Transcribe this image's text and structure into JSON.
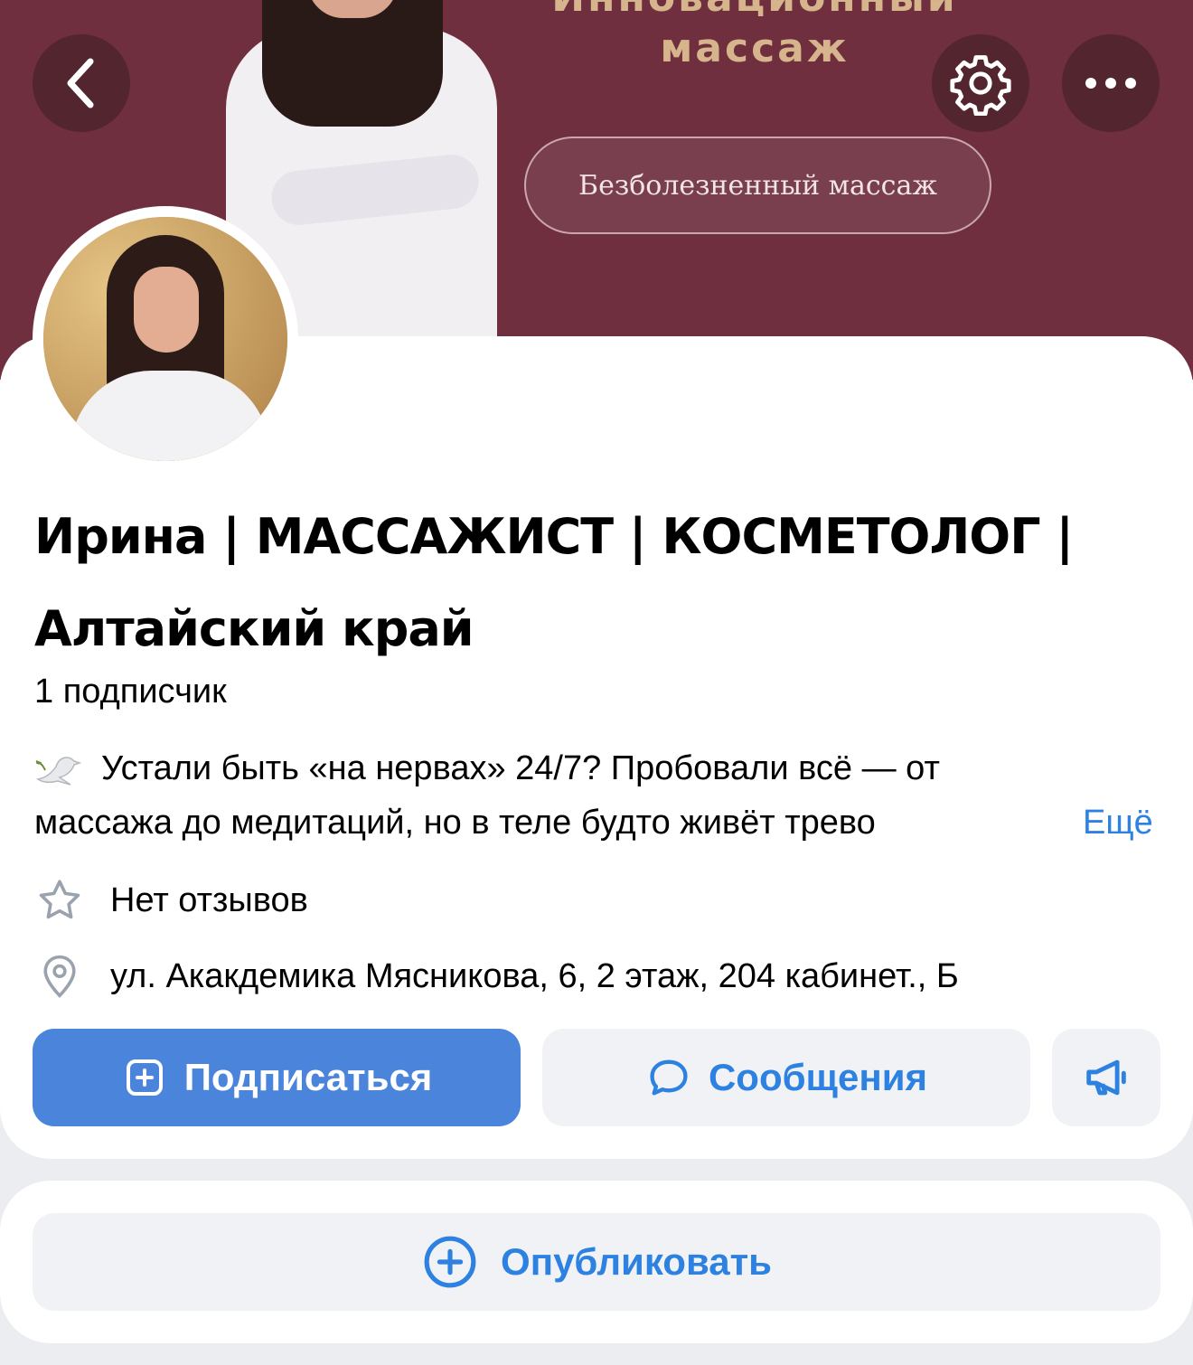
{
  "cover": {
    "heading_line1": "Инновационный",
    "heading_line2": "массаж",
    "tag": "Безболезненный массаж",
    "bg_color": "#6f2f3f"
  },
  "nav": {
    "back_icon": "chevron-left-icon",
    "settings_icon": "gear-icon",
    "more_icon": "ellipsis-icon"
  },
  "profile": {
    "title_line1": "Ирина | МАССАЖИСТ | КОСМЕТОЛОГ |",
    "title_line2": "Алтайский край",
    "subscribers": "1 подписчик",
    "description_line1": "Устали быть «на нервах» 24/7? Пробовали всё — от",
    "description_line2": "массажа до медитаций, но в теле будто живёт трево",
    "more_link": "Ещё",
    "reviews": "Нет отзывов",
    "address": "ул. Акакдемика Мясникова, 6, 2 этаж, 204 кабинет., Б"
  },
  "actions": {
    "subscribe": "Подписаться",
    "messages": "Сообщения",
    "publish": "Опубликовать"
  },
  "colors": {
    "accent": "#2d81e0",
    "primary_button": "#4a84db",
    "secondary_button": "#f0f2f5"
  }
}
